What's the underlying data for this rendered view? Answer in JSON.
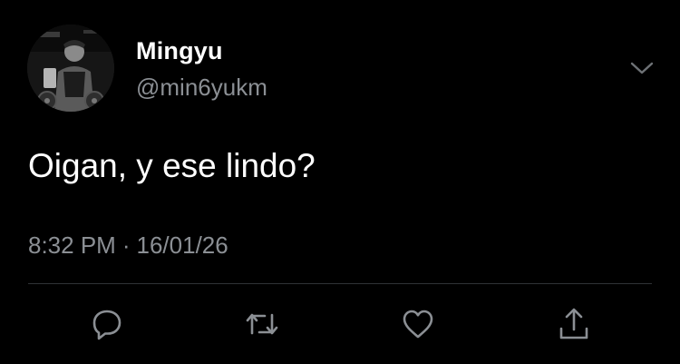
{
  "tweet": {
    "author": {
      "display_name": "Mingyu",
      "handle": "@min6yukm",
      "avatar_icon": "profile-photo"
    },
    "text": "Oigan, y ese lindo?",
    "time": "8:32 PM",
    "separator": "·",
    "date": "16/01/26",
    "menu_icon": "chevron-down-icon"
  },
  "actions": [
    {
      "name": "reply",
      "icon": "reply-icon"
    },
    {
      "name": "retweet",
      "icon": "retweet-icon"
    },
    {
      "name": "like",
      "icon": "heart-icon"
    },
    {
      "name": "share",
      "icon": "share-icon"
    }
  ],
  "colors": {
    "background": "#000000",
    "primary_text": "#ffffff",
    "secondary_text": "#8b8f94",
    "divider": "#2f3336",
    "icon": "#8b8f94"
  }
}
